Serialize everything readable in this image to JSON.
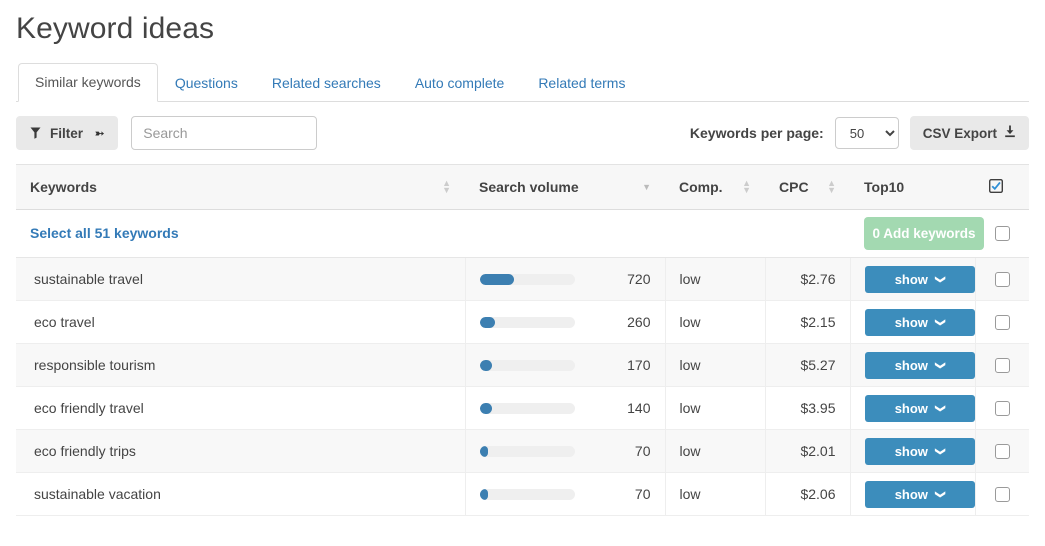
{
  "header": {
    "title": "Keyword ideas"
  },
  "tabs": [
    {
      "label": "Similar keywords",
      "active": true
    },
    {
      "label": "Questions",
      "active": false
    },
    {
      "label": "Related searches",
      "active": false
    },
    {
      "label": "Auto complete",
      "active": false
    },
    {
      "label": "Related terms",
      "active": false
    }
  ],
  "toolbar": {
    "filter_label": "Filter",
    "search_placeholder": "Search",
    "search_value": "",
    "per_page_label": "Keywords per page:",
    "per_page_value": "50",
    "per_page_options": [
      "50"
    ],
    "csv_export_label": "CSV Export"
  },
  "table": {
    "columns": {
      "keywords": "Keywords",
      "search_volume": "Search volume",
      "comp": "Comp.",
      "cpc": "CPC",
      "top10": "Top10"
    },
    "select_all_label": "Select all 51 keywords",
    "add_keywords_label": "0 Add keywords",
    "show_label": "show",
    "rows": [
      {
        "keyword": "sustainable travel",
        "volume": "720",
        "volume_pct": 36,
        "comp": "low",
        "cpc": "$2.76"
      },
      {
        "keyword": "eco travel",
        "volume": "260",
        "volume_pct": 16,
        "comp": "low",
        "cpc": "$2.15"
      },
      {
        "keyword": "responsible tourism",
        "volume": "170",
        "volume_pct": 13,
        "comp": "low",
        "cpc": "$5.27"
      },
      {
        "keyword": "eco friendly travel",
        "volume": "140",
        "volume_pct": 13,
        "comp": "low",
        "cpc": "$3.95"
      },
      {
        "keyword": "eco friendly trips",
        "volume": "70",
        "volume_pct": 9,
        "comp": "low",
        "cpc": "$2.01"
      },
      {
        "keyword": "sustainable vacation",
        "volume": "70",
        "volume_pct": 9,
        "comp": "low",
        "cpc": "$2.06"
      }
    ]
  },
  "colors": {
    "accent_blue": "#337ab7",
    "button_blue": "#3c8dbc",
    "bar_blue": "#3c7fb1",
    "add_green": "#a3d9b1"
  }
}
